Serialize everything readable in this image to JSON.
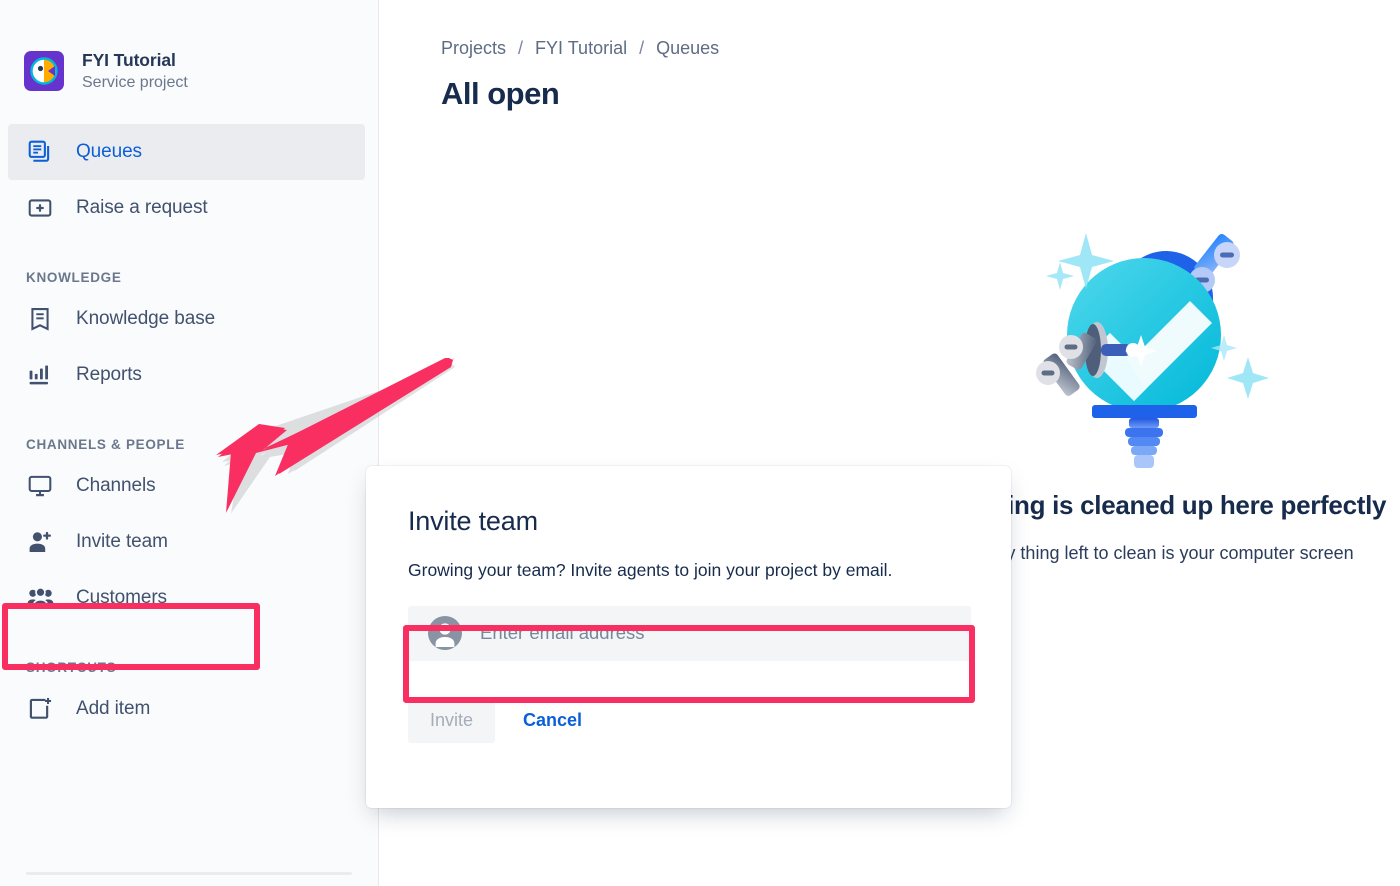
{
  "sidebar": {
    "project": {
      "avatar_icon": "project-avatar-logo",
      "name": "FYI Tutorial",
      "type": "Service project",
      "avatar_bg": "#6633cc"
    },
    "nav": [
      {
        "icon": "queues-icon",
        "label": "Queues",
        "active": true
      },
      {
        "icon": "raise-request-icon",
        "label": "Raise a request",
        "active": false
      }
    ],
    "sections": [
      {
        "label": "KNOWLEDGE",
        "items": [
          {
            "icon": "knowledge-base-icon",
            "label": "Knowledge base"
          },
          {
            "icon": "reports-icon",
            "label": "Reports"
          }
        ]
      },
      {
        "label": "CHANNELS & PEOPLE",
        "items": [
          {
            "icon": "channels-icon",
            "label": "Channels"
          },
          {
            "icon": "invite-team-icon",
            "label": "Invite team"
          },
          {
            "icon": "customers-icon",
            "label": "Customers"
          }
        ]
      },
      {
        "label": "SHORTCUTS",
        "items": [
          {
            "icon": "add-item-icon",
            "label": "Add item"
          }
        ]
      }
    ]
  },
  "main": {
    "breadcrumb": {
      "items": [
        "Projects",
        "FYI Tutorial",
        "Queues"
      ],
      "separator": "/"
    },
    "page_title": "All open",
    "empty_state": {
      "illustration": "robot-polishing-checkmark-illustration",
      "heading": "Everything is cleaned up here perfectly",
      "subtext": "The only thing left to clean is your computer screen"
    }
  },
  "dialog": {
    "title": "Invite team",
    "description": "Growing your team? Invite agents to join your project by email.",
    "email_input": {
      "icon": "person-avatar-icon",
      "value": "",
      "placeholder": "Enter email address"
    },
    "invite_label": "Invite",
    "cancel_label": "Cancel"
  },
  "annotations": {
    "color": "#f92f62",
    "arrow": "arrow-pointing-to-invite-team",
    "highlight_invite_team": "invite-team-sidebar-highlight",
    "highlight_email_field": "email-input-highlight"
  },
  "colors": {
    "accent_blue": "#0b5fd8",
    "annotation_pink": "#f92f62",
    "text_dark": "#172b4d",
    "text_muted": "#6b778c",
    "sidebar_bg": "#fafbfc",
    "active_item_bg": "#ebecf0"
  }
}
